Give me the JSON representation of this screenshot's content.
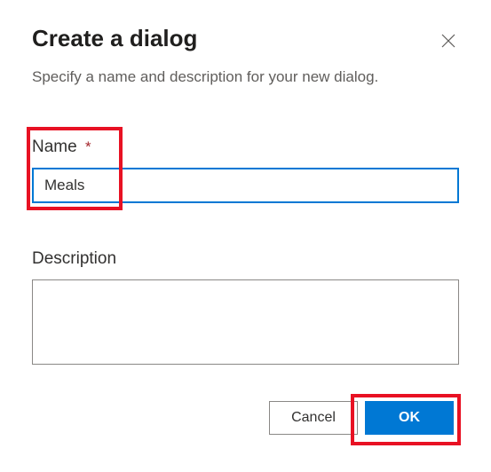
{
  "dialog": {
    "title": "Create a dialog",
    "subtitle": "Specify a name and description for your new dialog."
  },
  "fields": {
    "name": {
      "label": "Name",
      "required_mark": "*",
      "value": "Meals"
    },
    "description": {
      "label": "Description",
      "value": ""
    }
  },
  "buttons": {
    "cancel": "Cancel",
    "ok": "OK"
  },
  "icons": {
    "close": "close"
  }
}
